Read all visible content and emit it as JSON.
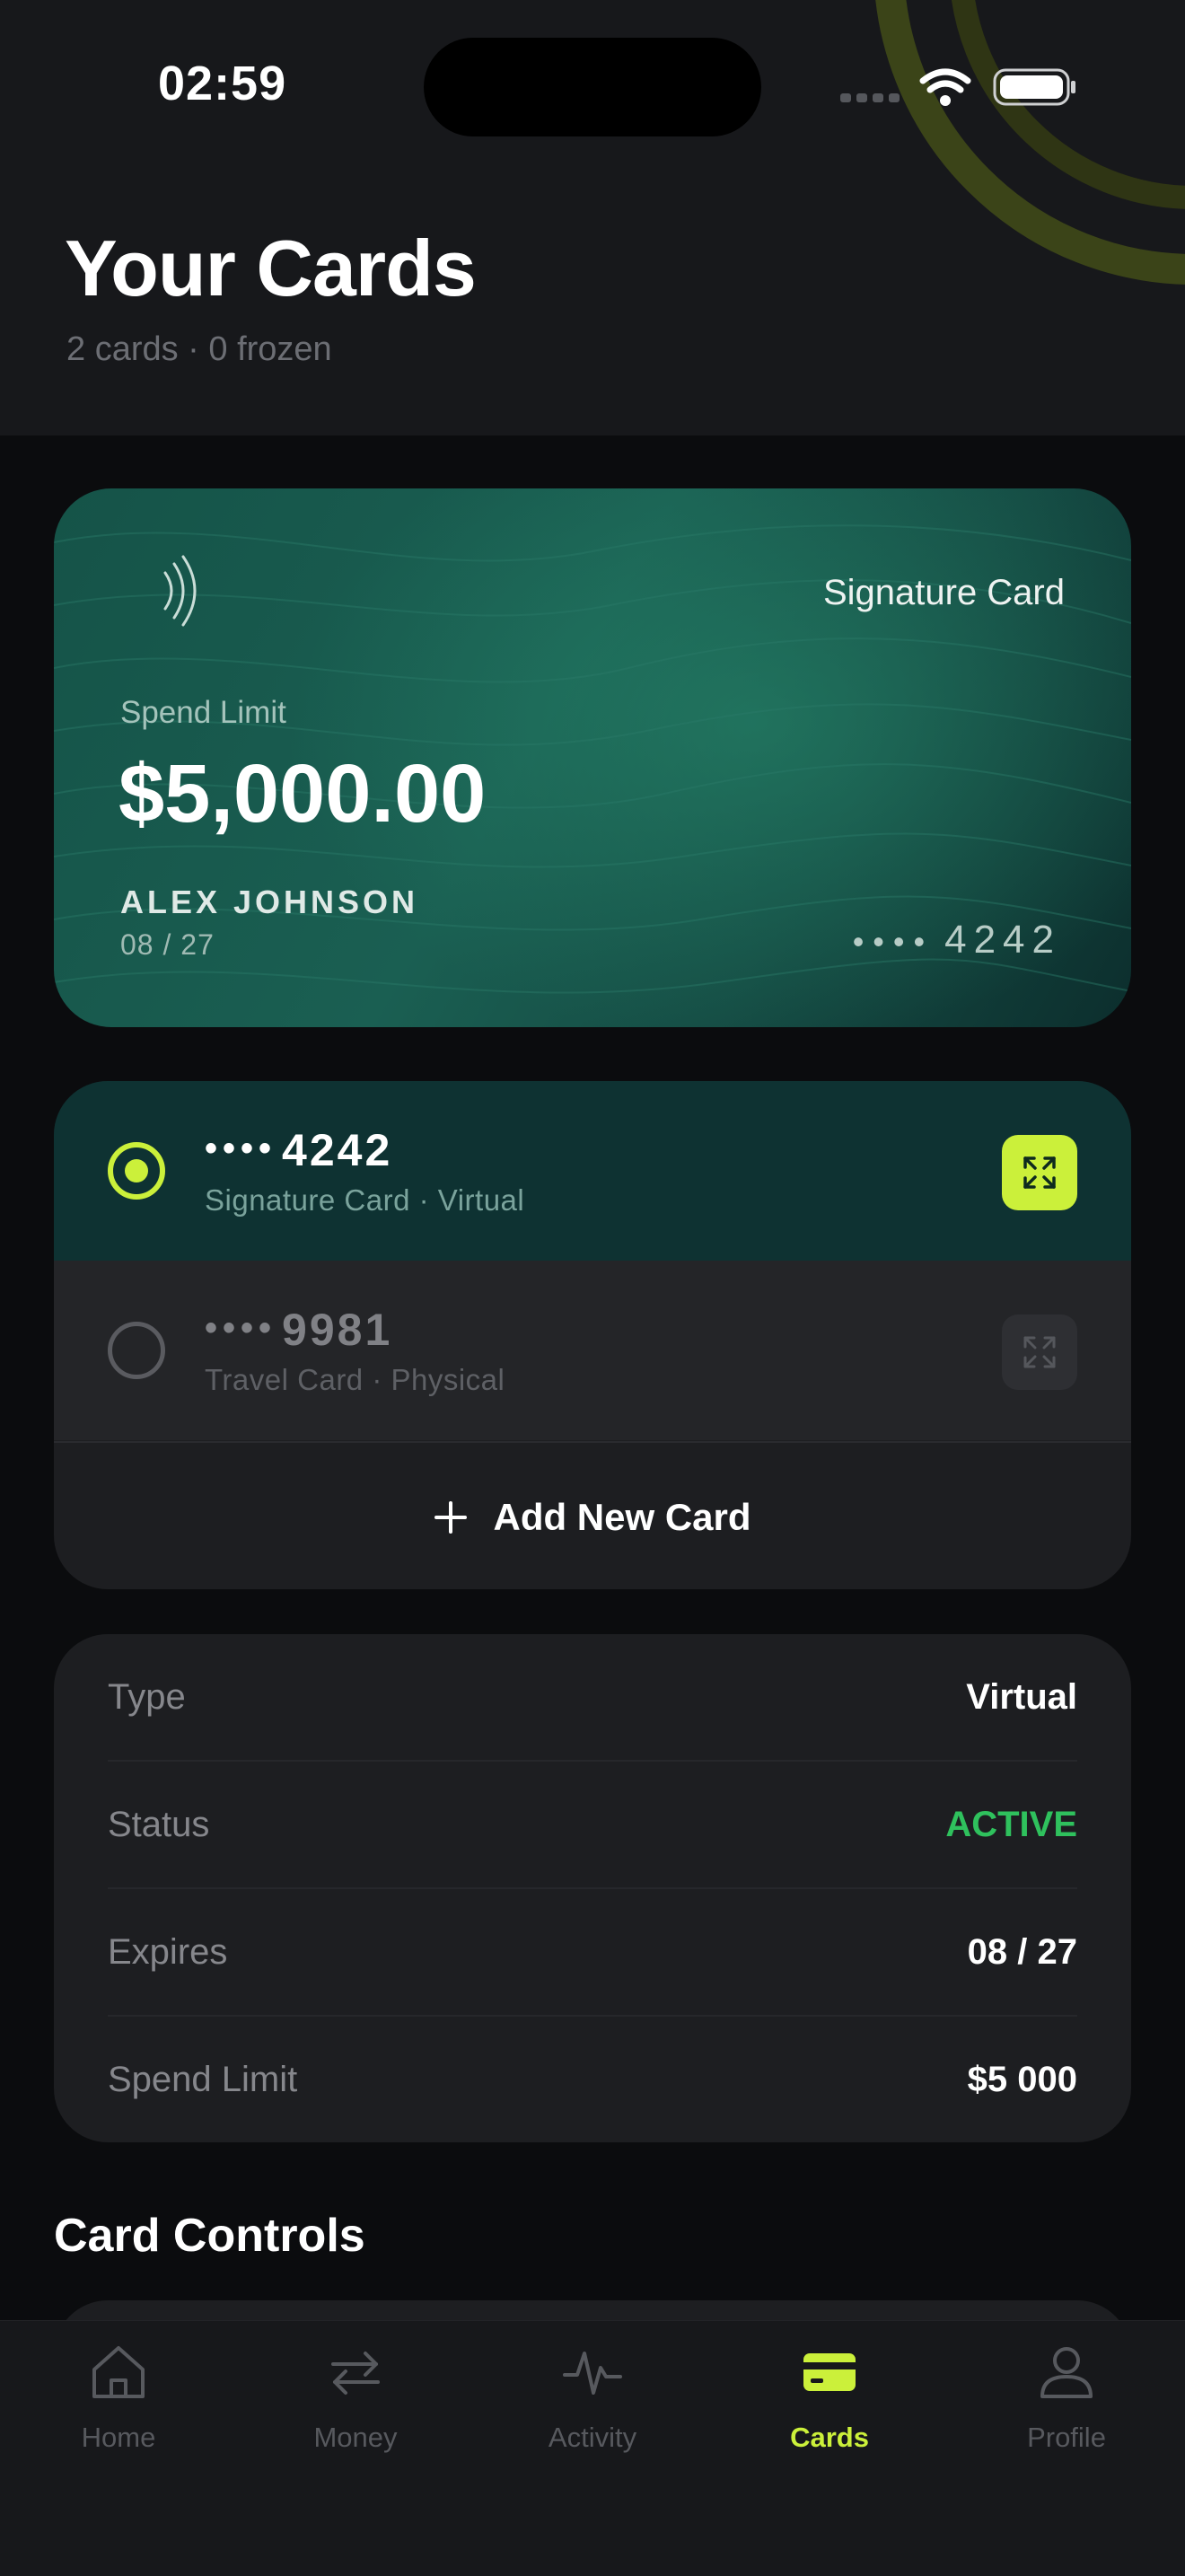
{
  "status_bar": {
    "time": "02:59"
  },
  "header": {
    "title": "Your Cards",
    "subtitle": "2 cards · 0 frozen"
  },
  "hero_card": {
    "label": "Signature Card",
    "spend_limit_label": "Spend Limit",
    "spend_limit_value": "$5,000.00",
    "holder_name": "ALEX JOHNSON",
    "expiry": "08 / 27",
    "masked_dots": "••••",
    "last4": "4242"
  },
  "card_list": {
    "items": [
      {
        "dots": "••••",
        "last4": "4242",
        "subtitle": "Signature Card · Virtual",
        "selected": true
      },
      {
        "dots": "••••",
        "last4": "9981",
        "subtitle": "Travel Card · Physical",
        "selected": false
      }
    ],
    "add_label": "Add New Card"
  },
  "details": {
    "rows": [
      {
        "key": "Type",
        "value": "Virtual"
      },
      {
        "key": "Status",
        "value": "ACTIVE"
      },
      {
        "key": "Expires",
        "value": "08 / 27"
      },
      {
        "key": "Spend Limit",
        "value": "$5 000"
      }
    ]
  },
  "section": {
    "title": "Card Controls"
  },
  "tabbar": {
    "items": [
      {
        "label": "Home",
        "icon": "home-icon"
      },
      {
        "label": "Money",
        "icon": "transfer-icon"
      },
      {
        "label": "Activity",
        "icon": "pulse-icon"
      },
      {
        "label": "Cards",
        "icon": "card-icon"
      },
      {
        "label": "Profile",
        "icon": "person-icon"
      }
    ],
    "active": "Cards"
  },
  "colors": {
    "accent": "#cbf03a",
    "status_active": "#2fc15d",
    "background": "#0b0c0e",
    "surface": "#1d1e21",
    "hero_green": "#1a5f52"
  }
}
